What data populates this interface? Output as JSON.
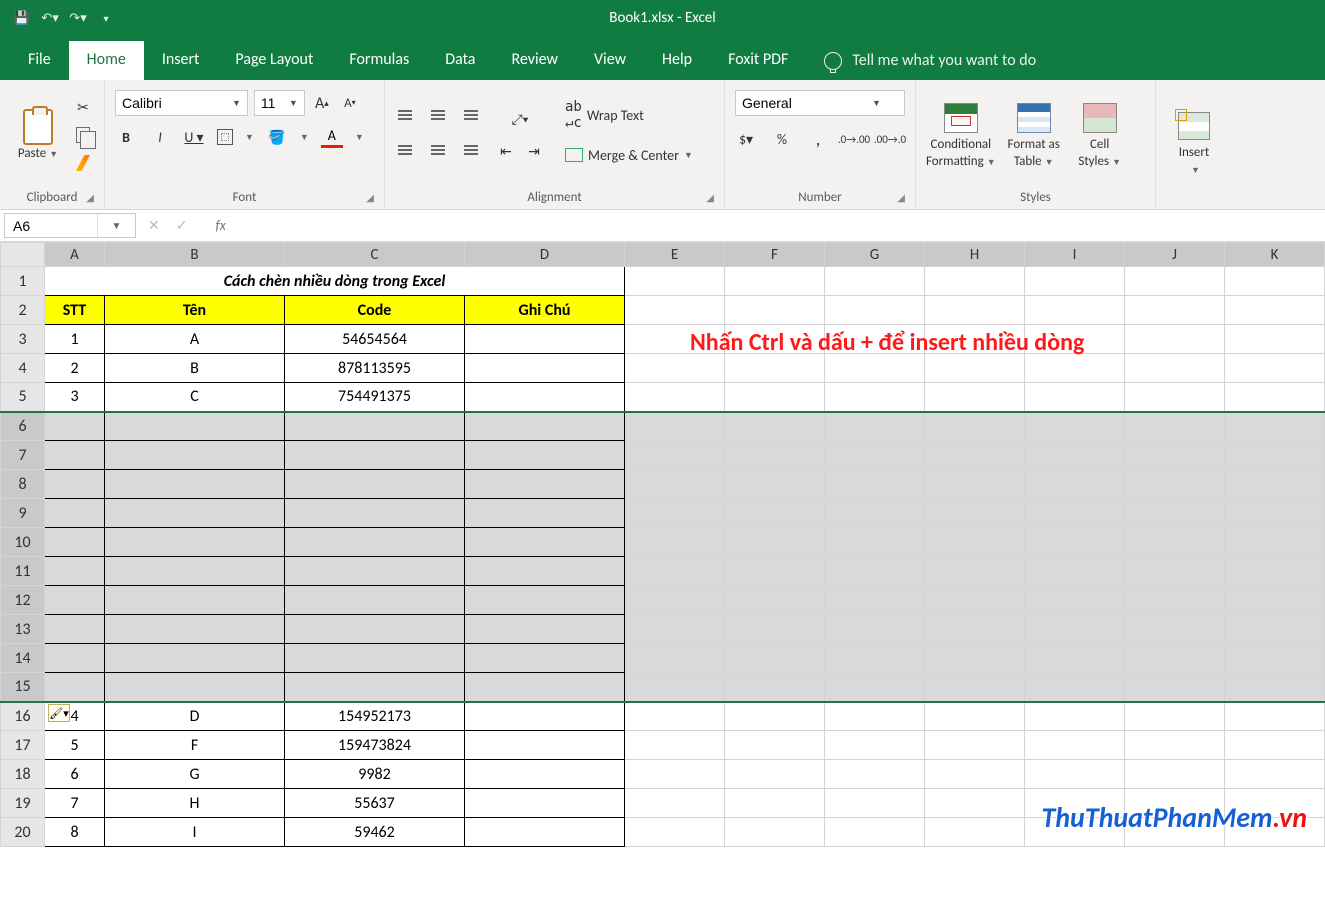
{
  "titlebar": {
    "title": "Book1.xlsx  -  Excel"
  },
  "tabs": {
    "file": "File",
    "home": "Home",
    "insert": "Insert",
    "page_layout": "Page Layout",
    "formulas": "Formulas",
    "data": "Data",
    "review": "Review",
    "view": "View",
    "help": "Help",
    "foxit": "Foxit PDF",
    "tellme": "Tell me what you want to do"
  },
  "ribbon": {
    "clipboard": {
      "label": "Clipboard",
      "paste": "Paste"
    },
    "font": {
      "label": "Font",
      "name": "Calibri",
      "size": "11"
    },
    "alignment": {
      "label": "Alignment",
      "wrap": "Wrap Text",
      "merge": "Merge & Center"
    },
    "number": {
      "label": "Number",
      "format": "General"
    },
    "styles": {
      "label": "Styles",
      "cond1": "Conditional",
      "cond2": "Formatting",
      "fmt1": "Format as",
      "fmt2": "Table",
      "cell1": "Cell",
      "cell2": "Styles"
    },
    "cells": {
      "insert": "Insert"
    }
  },
  "fbar": {
    "name": "A6",
    "fx": "fx"
  },
  "columns": [
    "A",
    "B",
    "C",
    "D",
    "E",
    "F",
    "G",
    "H",
    "I",
    "J",
    "K"
  ],
  "rows": [
    "1",
    "2",
    "3",
    "4",
    "5",
    "6",
    "7",
    "8",
    "9",
    "10",
    "11",
    "12",
    "13",
    "14",
    "15",
    "16",
    "17",
    "18",
    "19",
    "20"
  ],
  "sheet": {
    "title_row": "Cách chèn nhiều dòng trong Excel",
    "headers": {
      "stt": "STT",
      "ten": "Tên",
      "code": "Code",
      "ghichu": "Ghi Chú"
    },
    "data_top": [
      {
        "stt": "1",
        "ten": "A",
        "code": "54654564"
      },
      {
        "stt": "2",
        "ten": "B",
        "code": "878113595"
      },
      {
        "stt": "3",
        "ten": "C",
        "code": "754491375"
      }
    ],
    "data_bottom": [
      {
        "stt": "4",
        "ten": "D",
        "code": "154952173"
      },
      {
        "stt": "5",
        "ten": "F",
        "code": "159473824"
      },
      {
        "stt": "6",
        "ten": "G",
        "code": "9982"
      },
      {
        "stt": "7",
        "ten": "H",
        "code": "55637"
      },
      {
        "stt": "8",
        "ten": "I",
        "code": "59462"
      }
    ]
  },
  "annotation": "Nhấn Ctrl và dấu + để insert nhiều dòng",
  "watermark": {
    "base": "ThuThuatPhanMem",
    "tld": ".vn"
  }
}
